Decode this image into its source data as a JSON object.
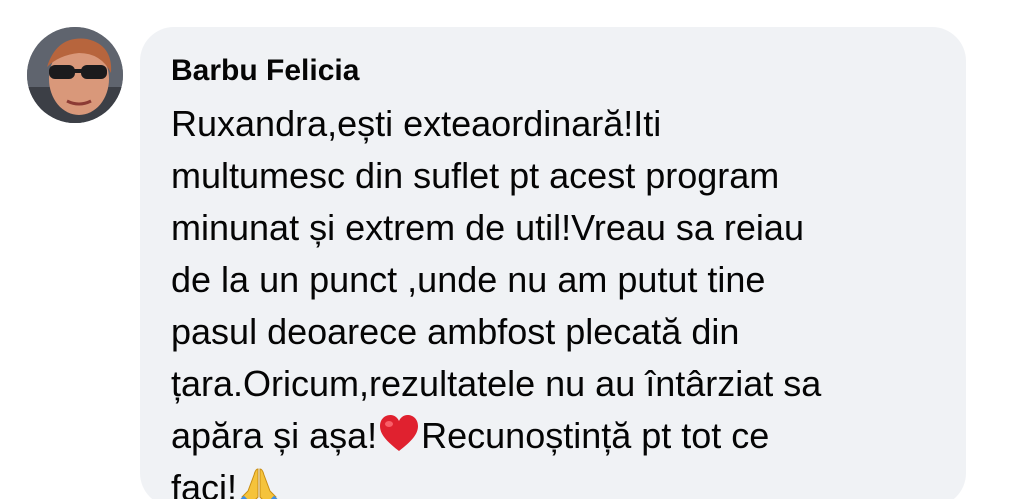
{
  "comment": {
    "author": "Barbu Felicia",
    "lines": [
      "Ruxandra,ești exteaordinară!Iti",
      "multumesc din suflet pt acest program",
      "minunat și extrem de util!Vreau sa reiau",
      "de la un punct ,unde nu am putut tine",
      "pasul deoarece ambfost plecată din",
      "țara.Oricum,rezultatele nu au întârziat sa"
    ],
    "line7_before_emoji": "apăra și așa!",
    "line7_after_emoji": "Recunoștință pt tot ce",
    "line8_text": "faci!",
    "emojis": [
      "heart-emoji",
      "praying-hands-emoji"
    ]
  },
  "colors": {
    "bubble_bg": "#f0f2f5",
    "text": "#050505",
    "heart": "#e0212f",
    "hands": "#f5c33b"
  }
}
